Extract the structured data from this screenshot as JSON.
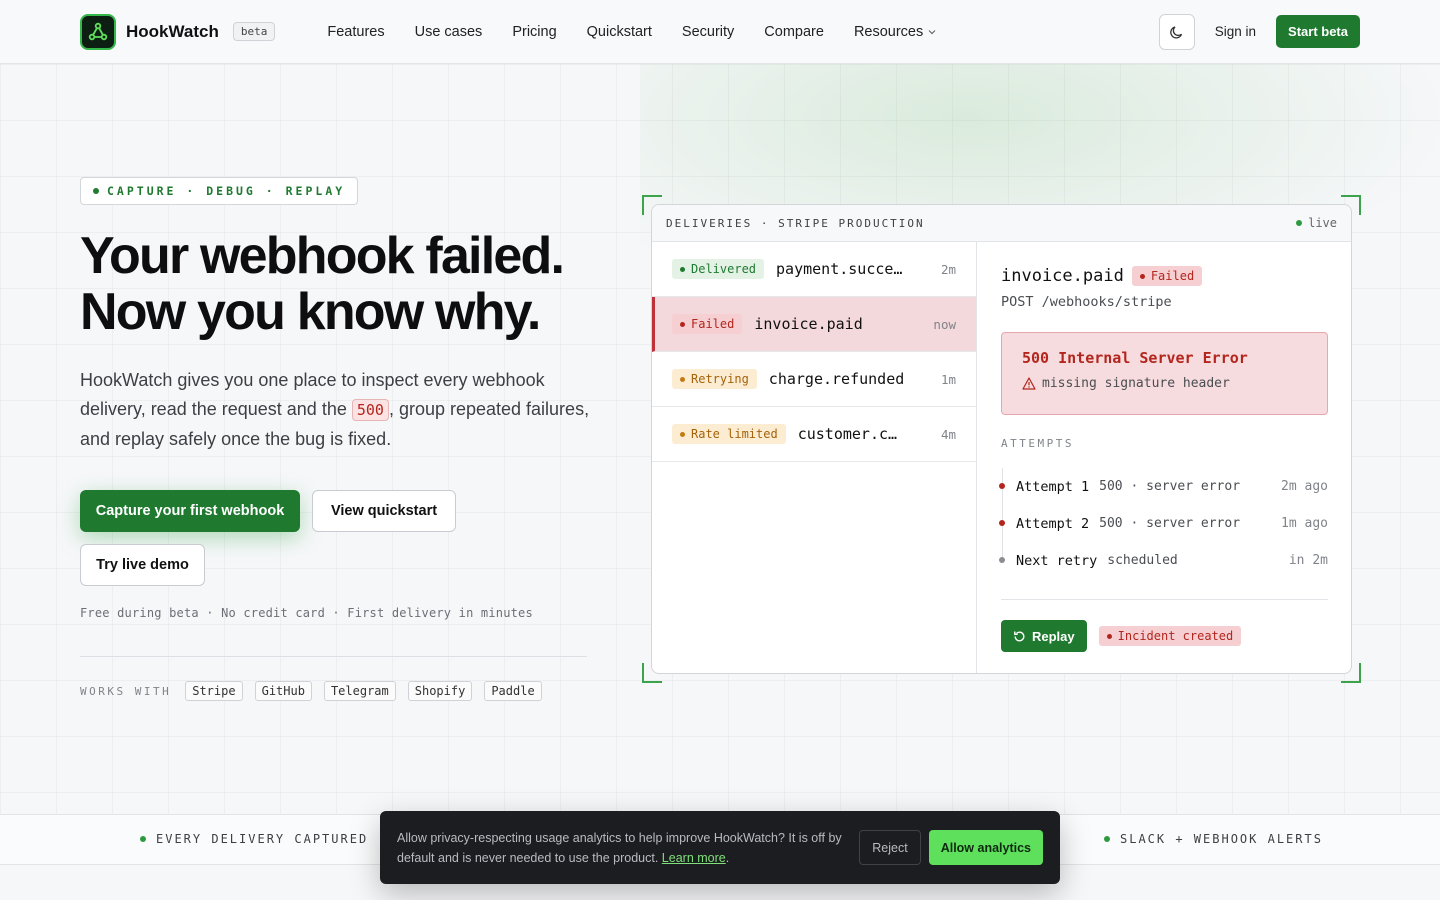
{
  "header": {
    "brand": "HookWatch",
    "beta_tag": "beta",
    "nav": [
      "Features",
      "Use cases",
      "Pricing",
      "Quickstart",
      "Security",
      "Compare",
      "Resources"
    ],
    "sign_in": "Sign in",
    "start": "Start beta"
  },
  "hero": {
    "eyebrow": "CAPTURE · DEBUG · REPLAY",
    "title_line1": "Your webhook failed.",
    "title_line2": "Now you know why.",
    "sub_before": "HookWatch gives you one place to inspect every webhook delivery, read the request and the ",
    "sub_code": "500",
    "sub_after": ", group repeated failures, and replay safely once the bug is fixed.",
    "cta_primary": "Capture your first webhook",
    "cta_quickstart": "View quickstart",
    "cta_demo": "Try live demo",
    "fineprint": "Free during beta · No credit card · First delivery in minutes",
    "works_label": "WORKS WITH",
    "integrations": [
      "Stripe",
      "GitHub",
      "Telegram",
      "Shopify",
      "Paddle"
    ]
  },
  "panel": {
    "header": "DELIVERIES · STRIPE PRODUCTION",
    "live": "live",
    "deliveries": [
      {
        "status": "Delivered",
        "name": "payment.succe…",
        "time": "2m"
      },
      {
        "status": "Failed",
        "name": "invoice.paid",
        "time": "now"
      },
      {
        "status": "Retrying",
        "name": "charge.refunded",
        "time": "1m"
      },
      {
        "status": "Rate limited",
        "name": "customer.c…",
        "time": "4m"
      }
    ],
    "detail": {
      "event": "invoice.paid",
      "status": "Failed",
      "route": "POST /webhooks/stripe",
      "error_title": "500 Internal Server Error",
      "error_sub": "missing signature header",
      "attempts_label": "ATTEMPTS",
      "attempts": [
        {
          "name": "Attempt 1",
          "desc": "500 · server error",
          "time": "2m ago"
        },
        {
          "name": "Attempt 2",
          "desc": "500 · server error",
          "time": "1m ago"
        },
        {
          "name": "Next retry",
          "desc": "scheduled",
          "time": "in 2m"
        }
      ],
      "replay": "Replay",
      "incident": "Incident created"
    }
  },
  "strip": {
    "left": "EVERY DELIVERY CAPTURED",
    "right": "SLACK + WEBHOOK ALERTS"
  },
  "cookie": {
    "text": "Allow privacy-respecting usage analytics to help improve HookWatch? It is off by default and is never needed to use the product.",
    "link": "Learn more",
    "reject": "Reject",
    "allow": "Allow analytics"
  },
  "colors": {
    "brand_green": "#1f7a30",
    "error_red": "#b3261e",
    "warning_amber": "#a5620a",
    "accent_light_green": "#5fe05c"
  }
}
